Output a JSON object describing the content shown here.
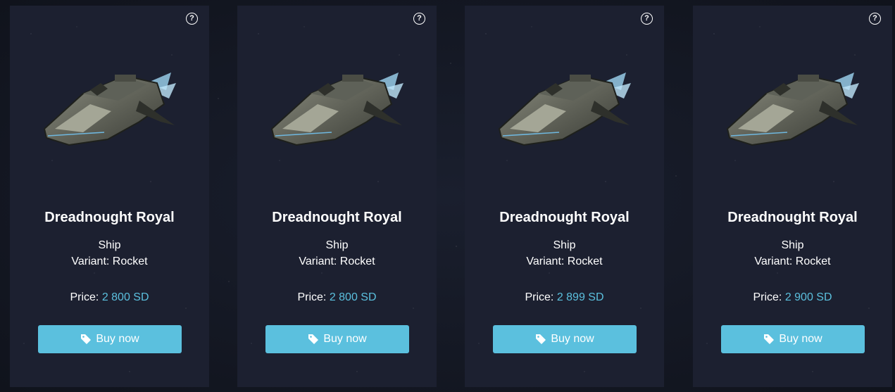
{
  "icons": {
    "help": "question-circle-icon",
    "tag": "tag-icon",
    "ship": "spaceship-image"
  },
  "colors": {
    "button_bg": "#5bc0de",
    "price_value": "#5bc0de",
    "card_bg": "#1c2030"
  },
  "cards": [
    {
      "help_glyph": "?",
      "name": "Dreadnought Royal",
      "type": "Ship",
      "variant": "Variant: Rocket",
      "price_label": "Price:",
      "price_value": "2 800 SD",
      "button_label": "Buy now"
    },
    {
      "help_glyph": "?",
      "name": "Dreadnought Royal",
      "type": "Ship",
      "variant": "Variant: Rocket",
      "price_label": "Price:",
      "price_value": "2 800 SD",
      "button_label": "Buy now"
    },
    {
      "help_glyph": "?",
      "name": "Dreadnought Royal",
      "type": "Ship",
      "variant": "Variant: Rocket",
      "price_label": "Price:",
      "price_value": "2 899 SD",
      "button_label": "Buy now"
    },
    {
      "help_glyph": "?",
      "name": "Dreadnought Royal",
      "type": "Ship",
      "variant": "Variant: Rocket",
      "price_label": "Price:",
      "price_value": "2 900 SD",
      "button_label": "Buy now"
    }
  ]
}
